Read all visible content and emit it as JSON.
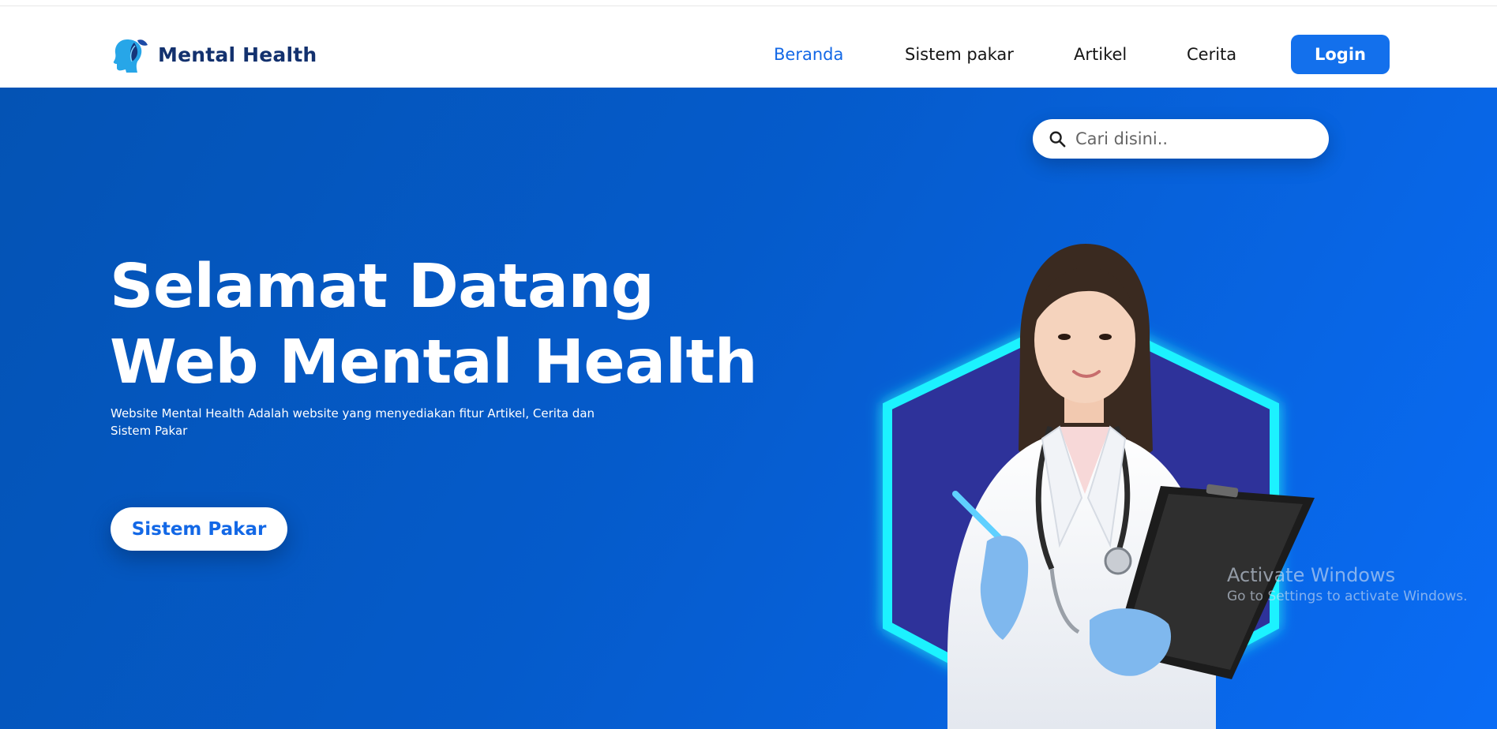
{
  "brand": {
    "name": "Mental Health",
    "logo_icon": "head-leaf-icon"
  },
  "nav": {
    "items": [
      {
        "label": "Beranda",
        "active": true
      },
      {
        "label": "Sistem pakar",
        "active": false
      },
      {
        "label": "Artikel",
        "active": false
      },
      {
        "label": "Cerita",
        "active": false
      }
    ],
    "login_label": "Login"
  },
  "search": {
    "placeholder": "Cari disini..",
    "icon": "search-icon"
  },
  "hero": {
    "title_line1": "Selamat Datang",
    "title_line2": "Web Mental Health",
    "description": "Website Mental Health Adalah website yang menyediakan fitur Artikel, Cerita dan Sistem Pakar",
    "cta_label": "Sistem Pakar",
    "image": "doctor-illustration"
  },
  "watermark": {
    "title": "Activate Windows",
    "subtitle": "Go to Settings to activate Windows."
  },
  "colors": {
    "primary": "#1370ec",
    "nav_active": "#1368e6",
    "brand_text": "#13316e",
    "hero_start": "#0453b4",
    "hero_end": "#0a6cf5",
    "hexagon_glow": "#1ff2ff",
    "hexagon_fill": "#2e309a"
  }
}
